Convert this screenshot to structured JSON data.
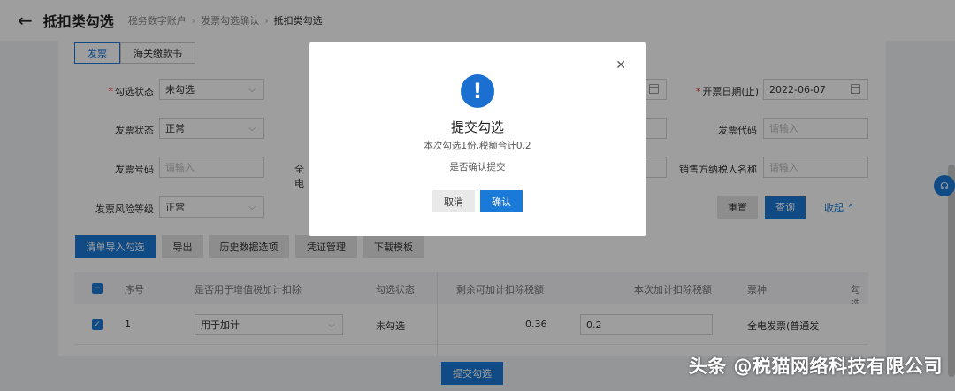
{
  "header": {
    "back_icon": "arrow-left-icon",
    "title": "抵扣类勾选",
    "breadcrumb": [
      "税务数字账户",
      "发票勾选确认",
      "抵扣类勾选"
    ]
  },
  "tabs": [
    "发票",
    "海关缴款书"
  ],
  "form": {
    "status_label": "勾选状态",
    "status_value": "未勾选",
    "invoice_date_end_label": "开票日期(止)",
    "invoice_date_end_value": "2022-06-07",
    "invoice_state_label": "发票状态",
    "invoice_state_value": "正常",
    "invoice_code_label": "发票代码",
    "invoice_code_placeholder": "请输入",
    "invoice_number_label": "发票号码",
    "invoice_number_placeholder": "请输入",
    "full_elec_label_fragment": "全电",
    "seller_taxpayer_label": "销售方纳税人名称",
    "seller_taxpayer_placeholder": "请输入",
    "risk_level_label": "发票风险等级",
    "risk_level_value": "正常",
    "reset_label": "重置",
    "query_label": "查询",
    "collapse_label": "收起"
  },
  "toolbar": [
    "清单导入勾选",
    "导出",
    "历史数据选项",
    "凭证管理",
    "下载模板"
  ],
  "table": {
    "headers": [
      "序号",
      "是否用于增值税加计扣除",
      "勾选状态",
      "剩余可加计扣除税额",
      "本次加计扣除税额",
      "票种",
      "勾选"
    ],
    "rows": [
      {
        "index": "1",
        "usage": "用于加计",
        "status": "未勾选",
        "remaining": "0.36",
        "current": "0.2",
        "type": "全电发票(普通发"
      }
    ]
  },
  "submit_label": "提交勾选",
  "modal": {
    "title": "提交勾选",
    "summary": "本次勾选1份,税额合计0.2",
    "question": "是否确认提交",
    "cancel_label": "取消",
    "confirm_label": "确认",
    "icon": "exclamation-icon"
  },
  "watermark": "头条 @税猫网络科技有限公司",
  "colors": {
    "primary": "#1a7ad9",
    "overlay": "rgba(0,0,0,0.38)"
  }
}
